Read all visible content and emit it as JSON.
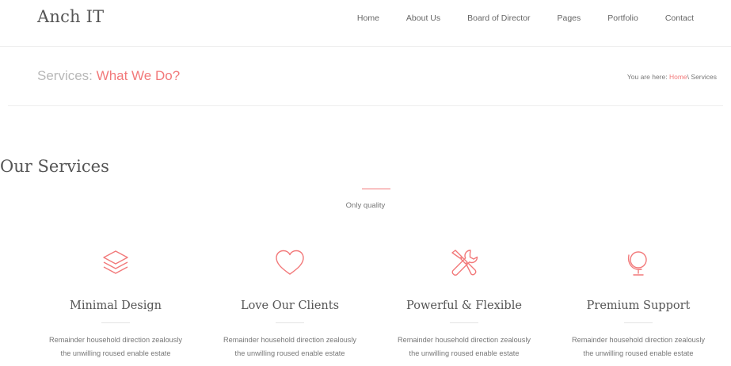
{
  "header": {
    "logo": "Anch IT",
    "nav": [
      "Home",
      "About Us",
      "Board of Director",
      "Pages",
      "Portfolio",
      "Contact"
    ]
  },
  "titlebar": {
    "title_prefix": "Services:",
    "title_accent": "What We Do?",
    "breadcrumb_label": "You are here:",
    "breadcrumb_home": "Home",
    "breadcrumb_current": "\\ Services"
  },
  "section": {
    "title": "Our Services",
    "subtitle": "Only quality"
  },
  "services": [
    {
      "icon": "layers-icon",
      "title": "Minimal Design",
      "line1": "Remainder household direction zealously",
      "line2": "the unwilling roused enable estate"
    },
    {
      "icon": "heart-icon",
      "title": "Love Our Clients",
      "line1": "Remainder household direction zealously",
      "line2": "the unwilling roused enable estate"
    },
    {
      "icon": "tools-icon",
      "title": "Powerful & Flexible",
      "line1": "Remainder household direction zealously",
      "line2": "the unwilling roused enable estate"
    },
    {
      "icon": "globe-icon",
      "title": "Premium Support",
      "line1": "Remainder household direction zealously",
      "line2": "the unwilling roused enable estate"
    }
  ],
  "colors": {
    "accent": "#f2797a",
    "text": "#555555",
    "muted": "#777777"
  }
}
